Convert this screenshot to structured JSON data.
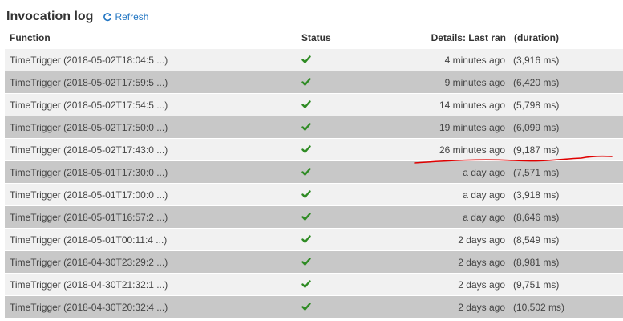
{
  "header": {
    "title": "Invocation log",
    "refresh_label": "Refresh"
  },
  "columns": {
    "function": "Function",
    "status": "Status",
    "details": "Details: Last ran",
    "duration": "(duration)"
  },
  "rows": [
    {
      "function": "TimeTrigger (2018-05-02T18:04:5 ...)",
      "status": "success",
      "ago": "4 minutes ago",
      "duration": "(3,916 ms)"
    },
    {
      "function": "TimeTrigger (2018-05-02T17:59:5 ...)",
      "status": "success",
      "ago": "9 minutes ago",
      "duration": "(6,420 ms)"
    },
    {
      "function": "TimeTrigger (2018-05-02T17:54:5 ...)",
      "status": "success",
      "ago": "14 minutes ago",
      "duration": "(5,798 ms)"
    },
    {
      "function": "TimeTrigger (2018-05-02T17:50:0 ...)",
      "status": "success",
      "ago": "19 minutes ago",
      "duration": "(6,099 ms)"
    },
    {
      "function": "TimeTrigger (2018-05-02T17:43:0 ...)",
      "status": "success",
      "ago": "26 minutes ago",
      "duration": "(9,187 ms)"
    },
    {
      "function": "TimeTrigger (2018-05-01T17:30:0 ...)",
      "status": "success",
      "ago": "a day ago",
      "duration": "(7,571 ms)"
    },
    {
      "function": "TimeTrigger (2018-05-01T17:00:0 ...)",
      "status": "success",
      "ago": "a day ago",
      "duration": "(3,918 ms)"
    },
    {
      "function": "TimeTrigger (2018-05-01T16:57:2 ...)",
      "status": "success",
      "ago": "a day ago",
      "duration": "(8,646 ms)"
    },
    {
      "function": "TimeTrigger (2018-05-01T00:11:4 ...)",
      "status": "success",
      "ago": "2 days ago",
      "duration": "(8,549 ms)"
    },
    {
      "function": "TimeTrigger (2018-04-30T23:29:2 ...)",
      "status": "success",
      "ago": "2 days ago",
      "duration": "(8,981 ms)"
    },
    {
      "function": "TimeTrigger (2018-04-30T21:32:1 ...)",
      "status": "success",
      "ago": "2 days ago",
      "duration": "(9,751 ms)"
    },
    {
      "function": "TimeTrigger (2018-04-30T20:32:4 ...)",
      "status": "success",
      "ago": "2 days ago",
      "duration": "(10,502 ms)"
    }
  ],
  "colors": {
    "accent": "#1f74c2",
    "check": "#2e8b23",
    "row_light": "#f1f1f1",
    "row_dark": "#c8c8c8",
    "annotation": "#e00000"
  },
  "icons": {
    "refresh": "refresh-icon",
    "status_success": "checkmark-icon"
  }
}
